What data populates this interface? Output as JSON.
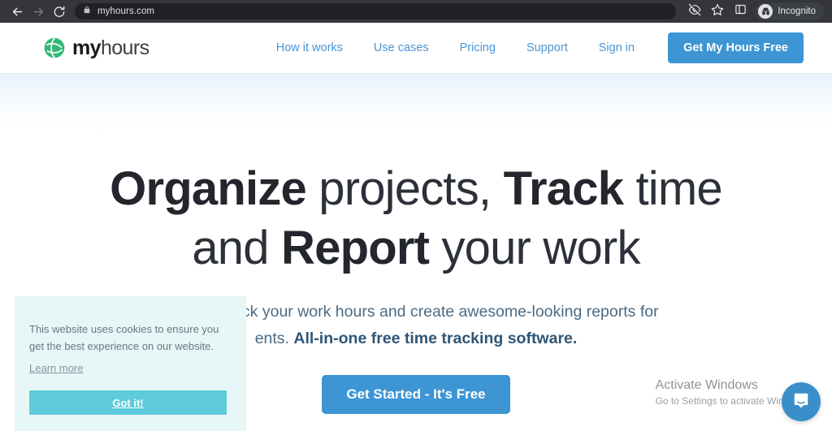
{
  "browser": {
    "back_icon": "arrow-left-icon",
    "forward_icon": "arrow-right-icon",
    "reload_icon": "reload-icon",
    "lock_icon": "lock-icon",
    "url": "myhours.com",
    "tracking_icon": "eye-off-icon",
    "bookmark_icon": "star-icon",
    "side_panel_icon": "side-panel-icon",
    "profile_icon": "incognito-avatar-icon",
    "profile_label": "Incognito"
  },
  "header": {
    "logo_icon": "myhours-globe-logo-icon",
    "logo_bold": "my",
    "logo_light": "hours",
    "nav": [
      {
        "label": "How it works"
      },
      {
        "label": "Use cases"
      },
      {
        "label": "Pricing"
      },
      {
        "label": "Support"
      },
      {
        "label": "Sign in"
      }
    ],
    "cta_label": "Get My Hours Free"
  },
  "hero": {
    "headline_line1_a": "Organize",
    "headline_line1_b": " projects, ",
    "headline_line1_c": "Track",
    "headline_line1_d": " time",
    "headline_line2_a": "and ",
    "headline_line2_b": "Report",
    "headline_line2_c": " your work",
    "subtitle_line1": "tasks. Track your work hours and create awesome-looking reports for",
    "subtitle_line2_a": "ents. ",
    "subtitle_line2_b": "All-in-one free time tracking software.",
    "cta_label": "Get Started - It's Free"
  },
  "cookie_banner": {
    "message": "This website uses cookies to ensure you get the best experience on our website.",
    "learn_more_label": "Learn more",
    "accept_label": "Got it!"
  },
  "watermark": {
    "title": "Activate Windows",
    "subtitle": "Go to Settings to activate Windows."
  },
  "chat": {
    "icon": "chat-bubble-icon"
  },
  "colors": {
    "brand_blue": "#3d95d4",
    "nav_link_blue": "#4a95d6",
    "logo_green": "#35b877",
    "cookie_bg": "#e7f6f6",
    "cookie_accept": "#5ecbdd",
    "chrome_bar": "#35363a",
    "headline_dark": "#2c3038",
    "subtitle_blue_gray": "#4a6b85"
  }
}
